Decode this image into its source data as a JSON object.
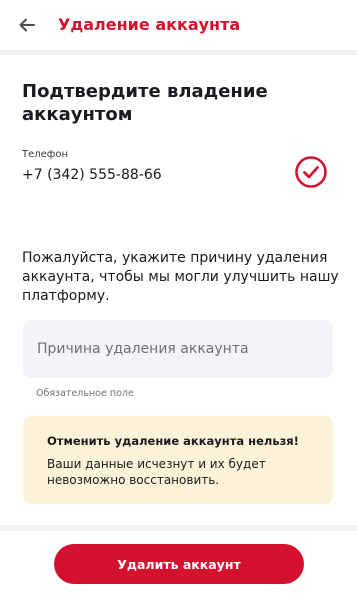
{
  "header": {
    "back_icon": "arrow-left-icon",
    "title": "Удаление аккаунта"
  },
  "confirm": {
    "title": "Подтвердите владение аккаунтом",
    "phone_label": "Телефон",
    "phone_value": "+7 (342) 555-88-66",
    "verified_icon": "check-circle-icon"
  },
  "reason": {
    "description": "Пожалуйста, укажите причину удаления аккаунта, чтобы мы могли улучшить нашу платформу.",
    "input_placeholder": "Причина удаления аккаунта",
    "input_value": "",
    "hint": "Обязательное поле"
  },
  "warning": {
    "title": "Отменить удаление аккаунта нельзя!",
    "text": "Ваши данные исчезнут и их будет невозможно восстановить."
  },
  "footer": {
    "delete_label": "Удалить аккаунт"
  },
  "colors": {
    "brand": "#d4122f",
    "warning_bg": "#fcf2d8",
    "input_bg": "#f3f4f7",
    "page_bg": "#f1f1f4"
  }
}
